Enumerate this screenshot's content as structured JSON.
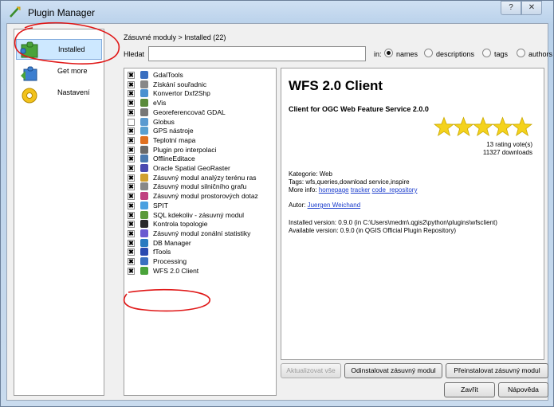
{
  "window": {
    "title": "Plugin Manager",
    "help_glyph": "?",
    "close_glyph": "✕"
  },
  "nav": {
    "items": [
      {
        "label": "Installed",
        "icon": "puzzle-installed-icon",
        "selected": true
      },
      {
        "label": "Get more",
        "icon": "puzzle-get-more-icon",
        "selected": false
      },
      {
        "label": "Nastavení",
        "icon": "gear-settings-icon",
        "selected": false
      }
    ]
  },
  "breadcrumb": "Zásuvné moduly > Installed (22)",
  "search": {
    "label": "Hledat",
    "value": "",
    "in_label": "in:"
  },
  "search_in": [
    {
      "label": "names",
      "selected": true
    },
    {
      "label": "descriptions",
      "selected": false
    },
    {
      "label": "tags",
      "selected": false
    },
    {
      "label": "authors",
      "selected": false
    }
  ],
  "plugins": [
    {
      "name": "GdalTools",
      "checked": true,
      "icon": "gdal-tools-icon"
    },
    {
      "name": "Získání souřadnic",
      "checked": true,
      "icon": "coordinate-capture-icon"
    },
    {
      "name": "Konvertor Dxf2Shp",
      "checked": true,
      "icon": "dxf2shp-icon"
    },
    {
      "name": "eVis",
      "checked": true,
      "icon": "evis-icon"
    },
    {
      "name": "Georeferencovač GDAL",
      "checked": true,
      "icon": "georeferencer-icon"
    },
    {
      "name": "Globus",
      "checked": false,
      "icon": "globe-icon"
    },
    {
      "name": "GPS nástroje",
      "checked": true,
      "icon": "gps-icon"
    },
    {
      "name": "Teplotní mapa",
      "checked": true,
      "icon": "heatmap-icon"
    },
    {
      "name": "Plugin pro interpolaci",
      "checked": true,
      "icon": "interpolation-icon"
    },
    {
      "name": "OfflineEditace",
      "checked": true,
      "icon": "offline-editing-icon"
    },
    {
      "name": "Oracle Spatial GeoRaster",
      "checked": true,
      "icon": "oracle-georaster-icon"
    },
    {
      "name": "Zásuvný modul analýzy terénu ras",
      "checked": true,
      "icon": "terrain-analysis-icon"
    },
    {
      "name": "Zásuvný modul silničního grafu",
      "checked": true,
      "icon": "road-graph-icon"
    },
    {
      "name": "Zásuvný modul prostorových dotaz",
      "checked": true,
      "icon": "spatial-query-icon"
    },
    {
      "name": "SPIT",
      "checked": true,
      "icon": "spit-icon"
    },
    {
      "name": "SQL kdekoliv - zásuvný modul",
      "checked": true,
      "icon": "sql-anywhere-icon"
    },
    {
      "name": "Kontrola topologie",
      "checked": true,
      "icon": "topology-checker-icon"
    },
    {
      "name": "Zásuvný modul zonální statistiky",
      "checked": true,
      "icon": "zonal-statistics-icon"
    },
    {
      "name": "DB Manager",
      "checked": true,
      "icon": "db-manager-icon"
    },
    {
      "name": "fTools",
      "checked": true,
      "icon": "ftools-icon"
    },
    {
      "name": "Processing",
      "checked": true,
      "icon": "processing-gear-icon"
    },
    {
      "name": "WFS 2.0 Client",
      "checked": true,
      "icon": "puzzle-piece-icon"
    }
  ],
  "details": {
    "title": "WFS 2.0 Client",
    "subtitle": "Client for OGC Web Feature Service 2.0.0",
    "rating_stars": 5,
    "votes": "13 rating vote(s)",
    "downloads": "11327 downloads",
    "category": "Kategorie: Web",
    "tags": "Tags: wfs,queries,download service,inspire",
    "more_info_label": "More info:",
    "link_homepage": "homepage",
    "link_tracker": "tracker",
    "link_repository": "code_repository",
    "author_label": "Autor:",
    "author": "Juergen Weichand",
    "installed_version": "Installed version: 0.9.0 (in C:\\Users\\medm\\.qgis2\\python\\plugins\\wfsclient)",
    "available_version": "Available version: 0.9.0 (in QGIS Official Plugin Repository)"
  },
  "buttons": {
    "upgrade_all": "Aktualizovat vše",
    "uninstall": "Odinstalovat zásuvný modul",
    "reinstall": "Přeinstalovat zásuvný modul",
    "close": "Zavřít",
    "help": "Nápověda"
  },
  "colors": {
    "annotation_red": "#e01818",
    "star_yellow": "#f4d21c",
    "link_blue": "#1a3ccc"
  }
}
